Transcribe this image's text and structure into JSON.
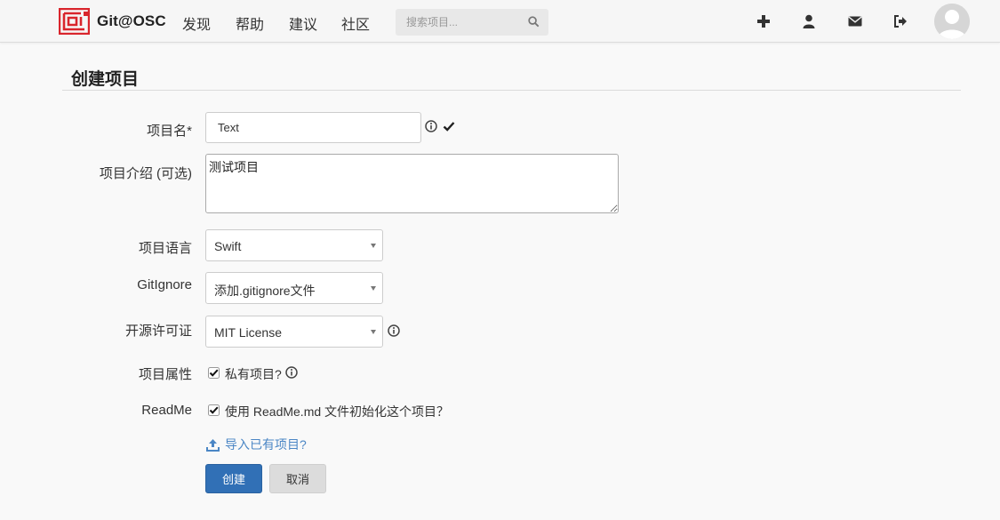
{
  "navbar": {
    "brand": "Git@OSC",
    "links": [
      "发现",
      "帮助",
      "建议",
      "社区"
    ],
    "search_placeholder": "搜索项目...",
    "icons": [
      "plus-icon",
      "user-icon",
      "envelope-icon",
      "sign-out-icon"
    ]
  },
  "page": {
    "title": "创建项目"
  },
  "form": {
    "name": {
      "label": "项目名*",
      "value": "Text"
    },
    "description": {
      "label": "项目介绍 (可选)",
      "value": "测试项目"
    },
    "language": {
      "label": "项目语言",
      "value": "Swift"
    },
    "gitignore": {
      "label": "GitIgnore",
      "value": "添加.gitignore文件"
    },
    "license": {
      "label": "开源许可证",
      "value": "MIT License"
    },
    "visibility": {
      "label": "项目属性",
      "checkbox_label": "私有项目?",
      "checked": true
    },
    "readme": {
      "label": "ReadMe",
      "checkbox_label": "使用 ReadMe.md 文件初始化这个项目？",
      "checked": true
    },
    "import_link": "导入已有项目?",
    "submit_label": "创建",
    "cancel_label": "取消"
  },
  "colors": {
    "brand_red": "#d9252c",
    "primary": "#3170b6",
    "link": "#4b86c5"
  }
}
